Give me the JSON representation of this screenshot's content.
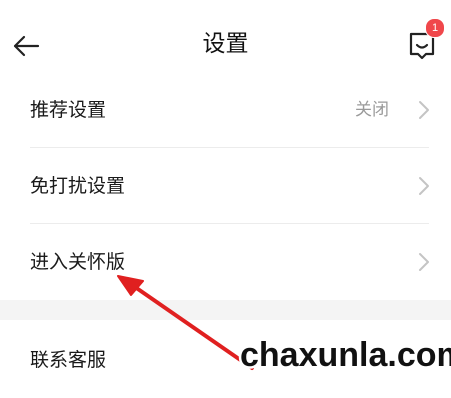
{
  "header": {
    "title": "设置",
    "badge_count": "1"
  },
  "settings": {
    "items": [
      {
        "label": "推荐设置",
        "value": "关闭"
      },
      {
        "label": "免打扰设置",
        "value": ""
      },
      {
        "label": "进入关怀版",
        "value": ""
      },
      {
        "label": "联系客服",
        "value": ""
      }
    ]
  },
  "annotation": {
    "arrow_color": "#e02020"
  },
  "watermark": {
    "text": "chaxunla.com"
  },
  "colors": {
    "badge": "#f0474b",
    "text_primary": "#1a1a1a",
    "text_secondary": "#9a9a9a",
    "section_gap": "#f4f4f4"
  }
}
